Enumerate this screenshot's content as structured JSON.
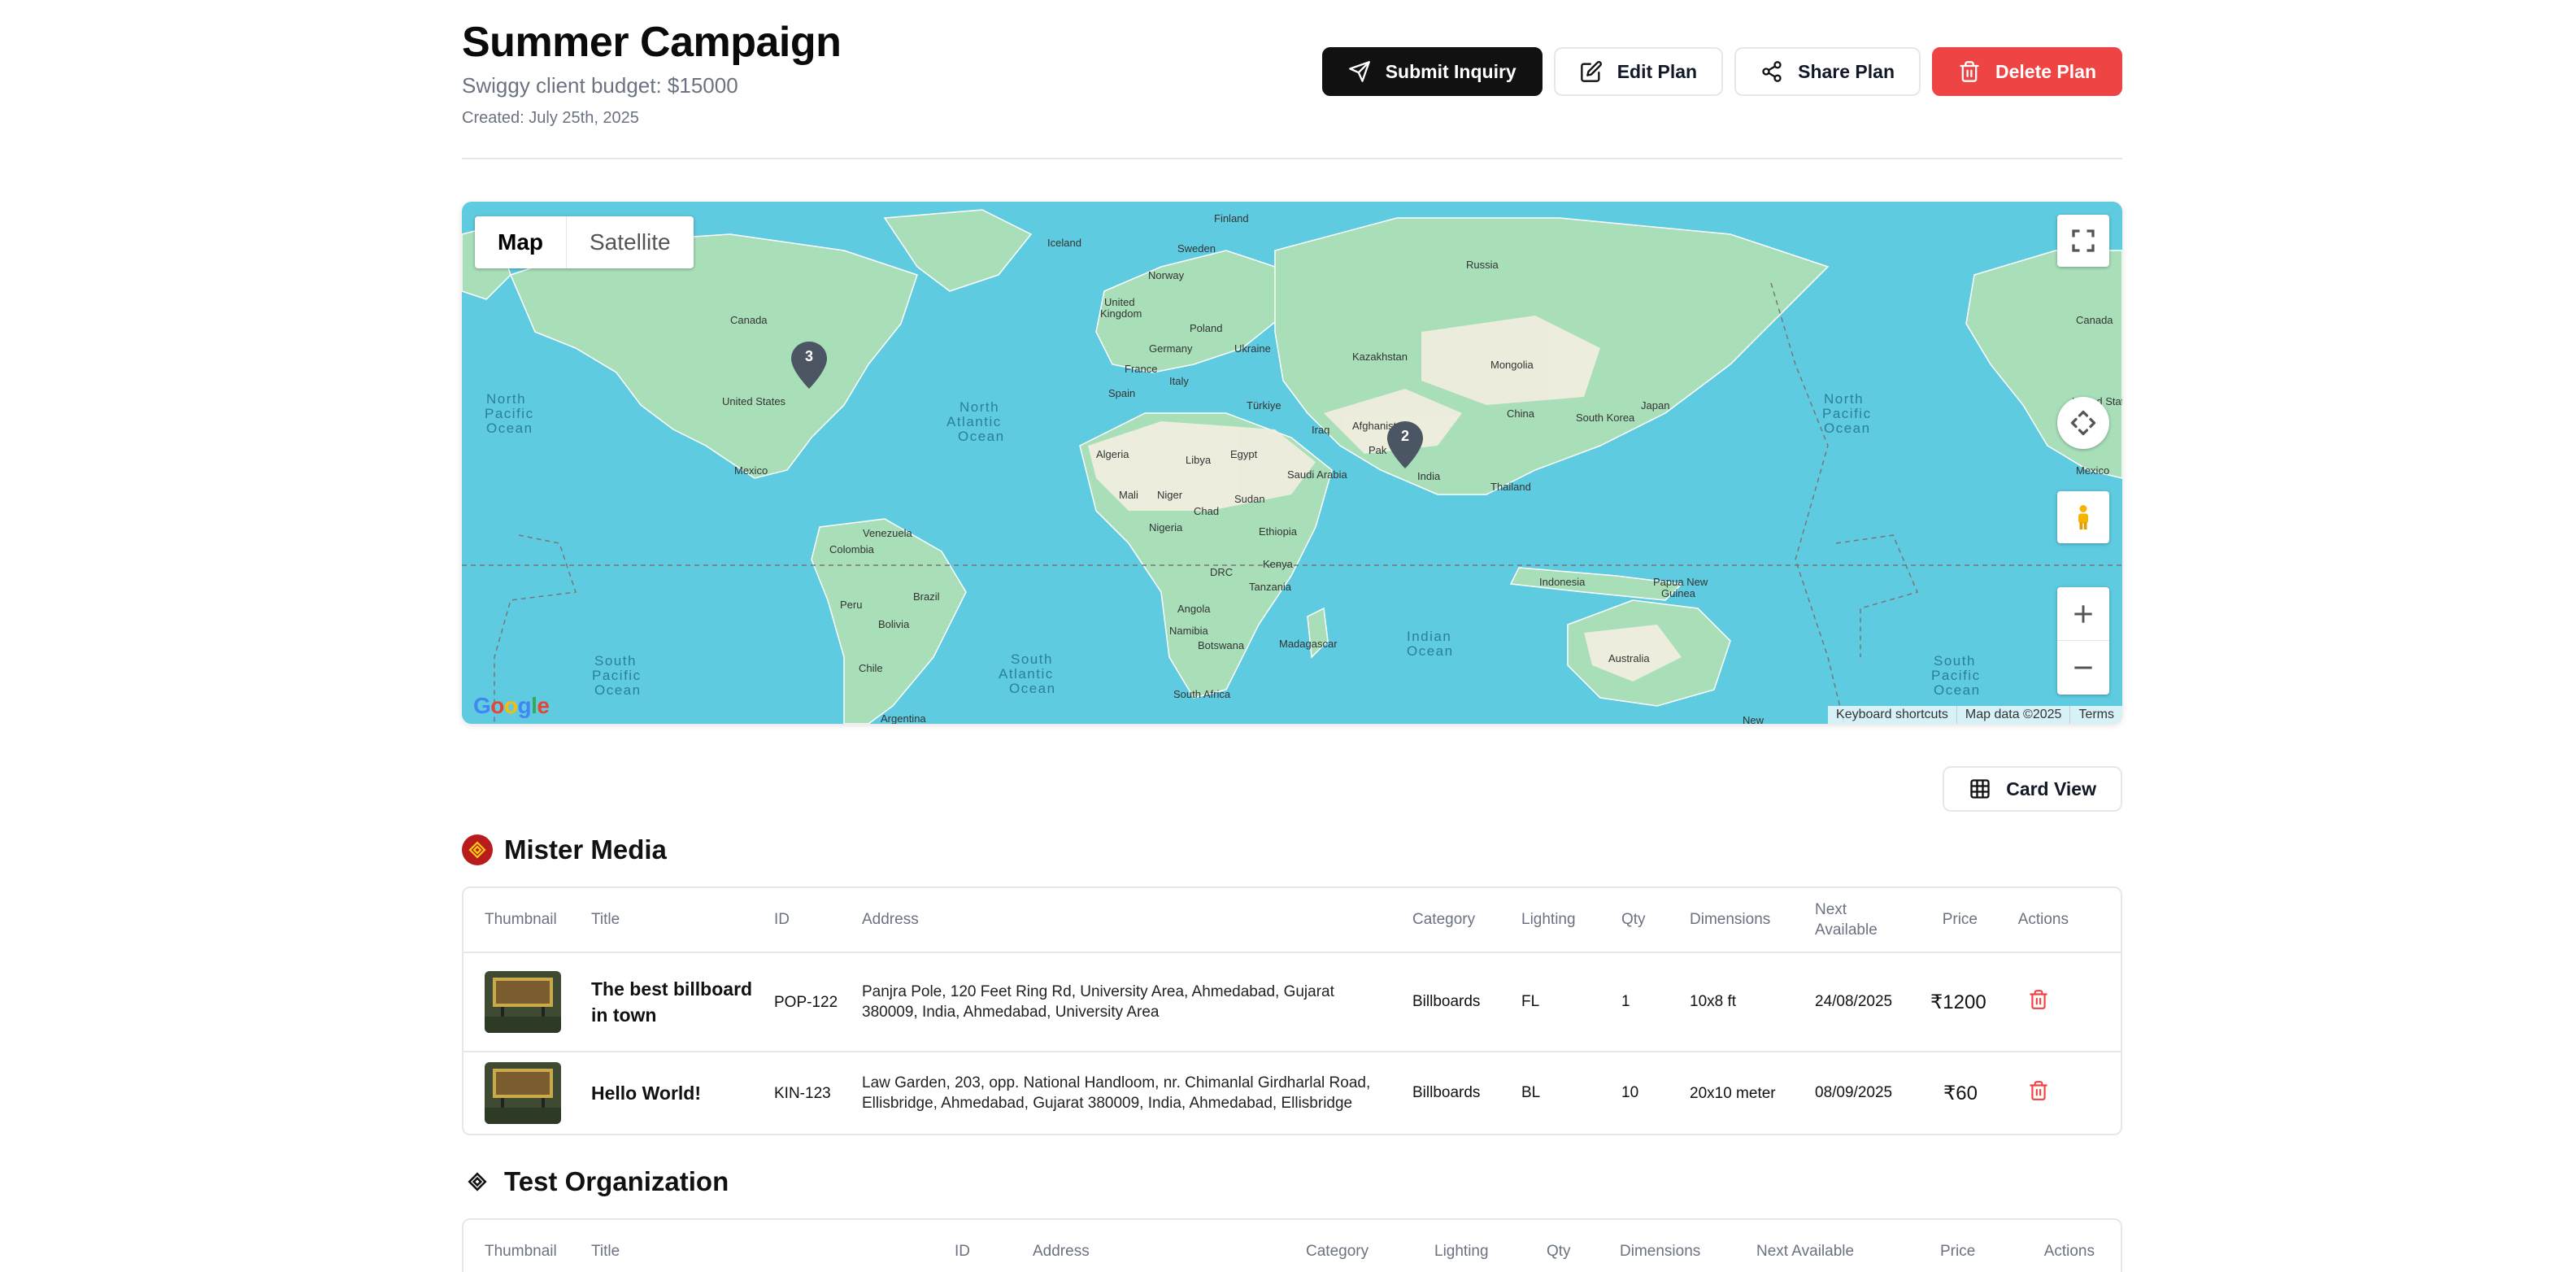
{
  "plan": {
    "title": "Summer Campaign",
    "budget": "Swiggy client budget: $15000",
    "created": "Created: July 25th, 2025"
  },
  "actions": {
    "submit": "Submit Inquiry",
    "edit": "Edit Plan",
    "share": "Share Plan",
    "delete": "Delete Plan"
  },
  "map": {
    "type_map": "Map",
    "type_satellite": "Satellite",
    "markers": [
      {
        "label": "3",
        "location": "United States"
      },
      {
        "label": "2",
        "location": "India"
      }
    ],
    "places": [
      "Iceland",
      "Finland",
      "Sweden",
      "Norway",
      "Russia",
      "United Kingdom",
      "Poland",
      "Ukraine",
      "Germany",
      "France",
      "Italy",
      "Spain",
      "Kazakhstan",
      "Mongolia",
      "Türkiye",
      "Iraq",
      "Afghanistan",
      "Pakistan",
      "China",
      "South Korea",
      "Japan",
      "Canada",
      "United States",
      "Mexico",
      "North Pacific Ocean",
      "North Atlantic Ocean",
      "Algeria",
      "Libya",
      "Egypt",
      "Saudi Arabia",
      "India",
      "Thailand",
      "Mali",
      "Niger",
      "Chad",
      "Sudan",
      "Ethiopia",
      "Nigeria",
      "Venezuela",
      "Colombia",
      "Peru",
      "Brazil",
      "Bolivia",
      "Chile",
      "Argentina",
      "DRC",
      "Kenya",
      "Tanzania",
      "Angola",
      "Namibia",
      "Botswana",
      "Madagascar",
      "South Africa",
      "Indian Ocean",
      "Indonesia",
      "Papua New Guinea",
      "Australia",
      "South Pacific Ocean",
      "South Atlantic Ocean",
      "New"
    ],
    "footer": {
      "shortcuts": "Keyboard shortcuts",
      "data": "Map data ©2025",
      "terms": "Terms"
    },
    "google": [
      "G",
      "o",
      "o",
      "g",
      "l",
      "e"
    ]
  },
  "view_toggle": "Card View",
  "columns_full": [
    "Thumbnail",
    "Title",
    "ID",
    "Address",
    "Category",
    "Lighting",
    "Qty",
    "Dimensions",
    "Next\nAvailable",
    "Price",
    "Actions"
  ],
  "columns_compact": [
    "Thumbnail",
    "Title",
    "ID",
    "Address",
    "Category",
    "Lighting",
    "Qty",
    "Dimensions",
    "Next Available",
    "Price",
    "Actions"
  ],
  "vendors": [
    {
      "name": "Mister Media",
      "rows": [
        {
          "title": "The best billboard in town",
          "id": "POP-122",
          "address": "Panjra Pole, 120 Feet Ring Rd, University Area, Ahmedabad, Gujarat 380009, India, Ahmedabad, University Area",
          "category": "Billboards",
          "lighting": "FL",
          "qty": "1",
          "dimensions": "10x8 ft",
          "next_available": "24/08/2025",
          "price": "₹1200"
        },
        {
          "title": "Hello World!",
          "id": "KIN-123",
          "address": "Law Garden, 203, opp. National Handloom, nr. Chimanlal Girdharlal Road, Ellisbridge, Ahmedabad, Gujarat 380009, India, Ahmedabad, Ellisbridge",
          "category": "Billboards",
          "lighting": "BL",
          "qty": "10",
          "dimensions": "20x10 meter",
          "next_available": "08/09/2025",
          "price": "₹60"
        }
      ]
    },
    {
      "name": "Test Organization",
      "rows": []
    }
  ],
  "colors": {
    "primary": "#111111",
    "danger": "#ef4444",
    "ocean": "#5fcbe0",
    "land": "#a8dfb9",
    "desert": "#f3eee0",
    "border": "#e5e7eb"
  }
}
